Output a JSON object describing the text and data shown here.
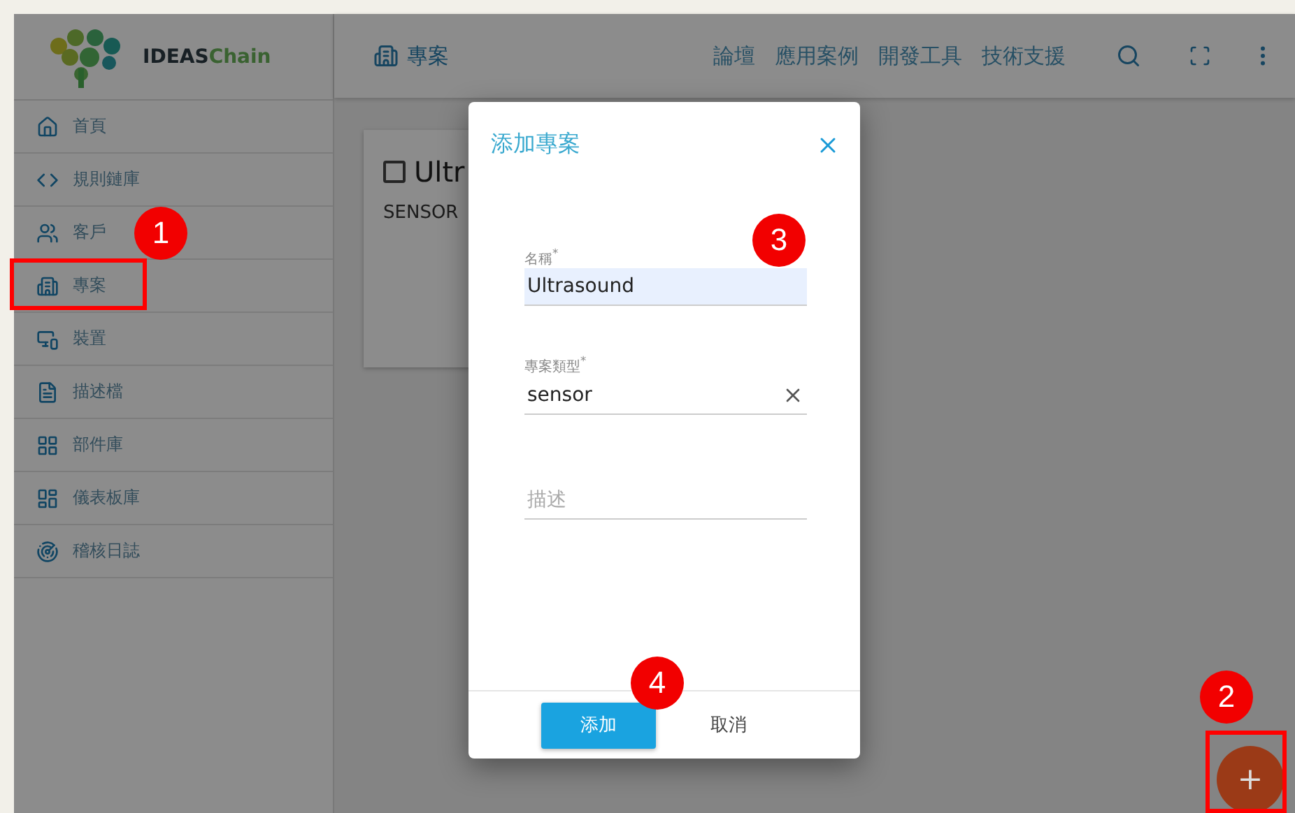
{
  "brand": {
    "name_part1": "IDEAS",
    "name_part2": "Chain"
  },
  "sidebar": {
    "items": [
      {
        "label": "首頁"
      },
      {
        "label": "規則鏈庫"
      },
      {
        "label": "客戶"
      },
      {
        "label": "專案"
      },
      {
        "label": "裝置"
      },
      {
        "label": "描述檔"
      },
      {
        "label": "部件庫"
      },
      {
        "label": "儀表板庫"
      },
      {
        "label": "稽核日誌"
      }
    ]
  },
  "topbar": {
    "title": "專案",
    "links": [
      "論壇",
      "應用案例",
      "開發工具",
      "技術支援"
    ]
  },
  "cards": [
    {
      "title": "Ultr",
      "checked": false,
      "type": "SENSOR"
    }
  ],
  "dialog": {
    "title": "添加專案",
    "fields": [
      {
        "label": "名稱$^{*}$",
        "value": "Ultrasound",
        "autofilled": true,
        "clearable": false
      },
      {
        "label": "專案類型$^{*}$",
        "value": "sensor",
        "autofilled": false,
        "clearable": true
      },
      {
        "placeholder": "描述",
        "autofilled": false,
        "clearable": false
      }
    ],
    "primary_button": "添加",
    "secondary_button": "取消"
  },
  "fab": {
    "label": "+"
  },
  "annotations": [
    {
      "number": "1"
    },
    {
      "number": "2"
    },
    {
      "number": "3"
    },
    {
      "number": "4"
    }
  ]
}
